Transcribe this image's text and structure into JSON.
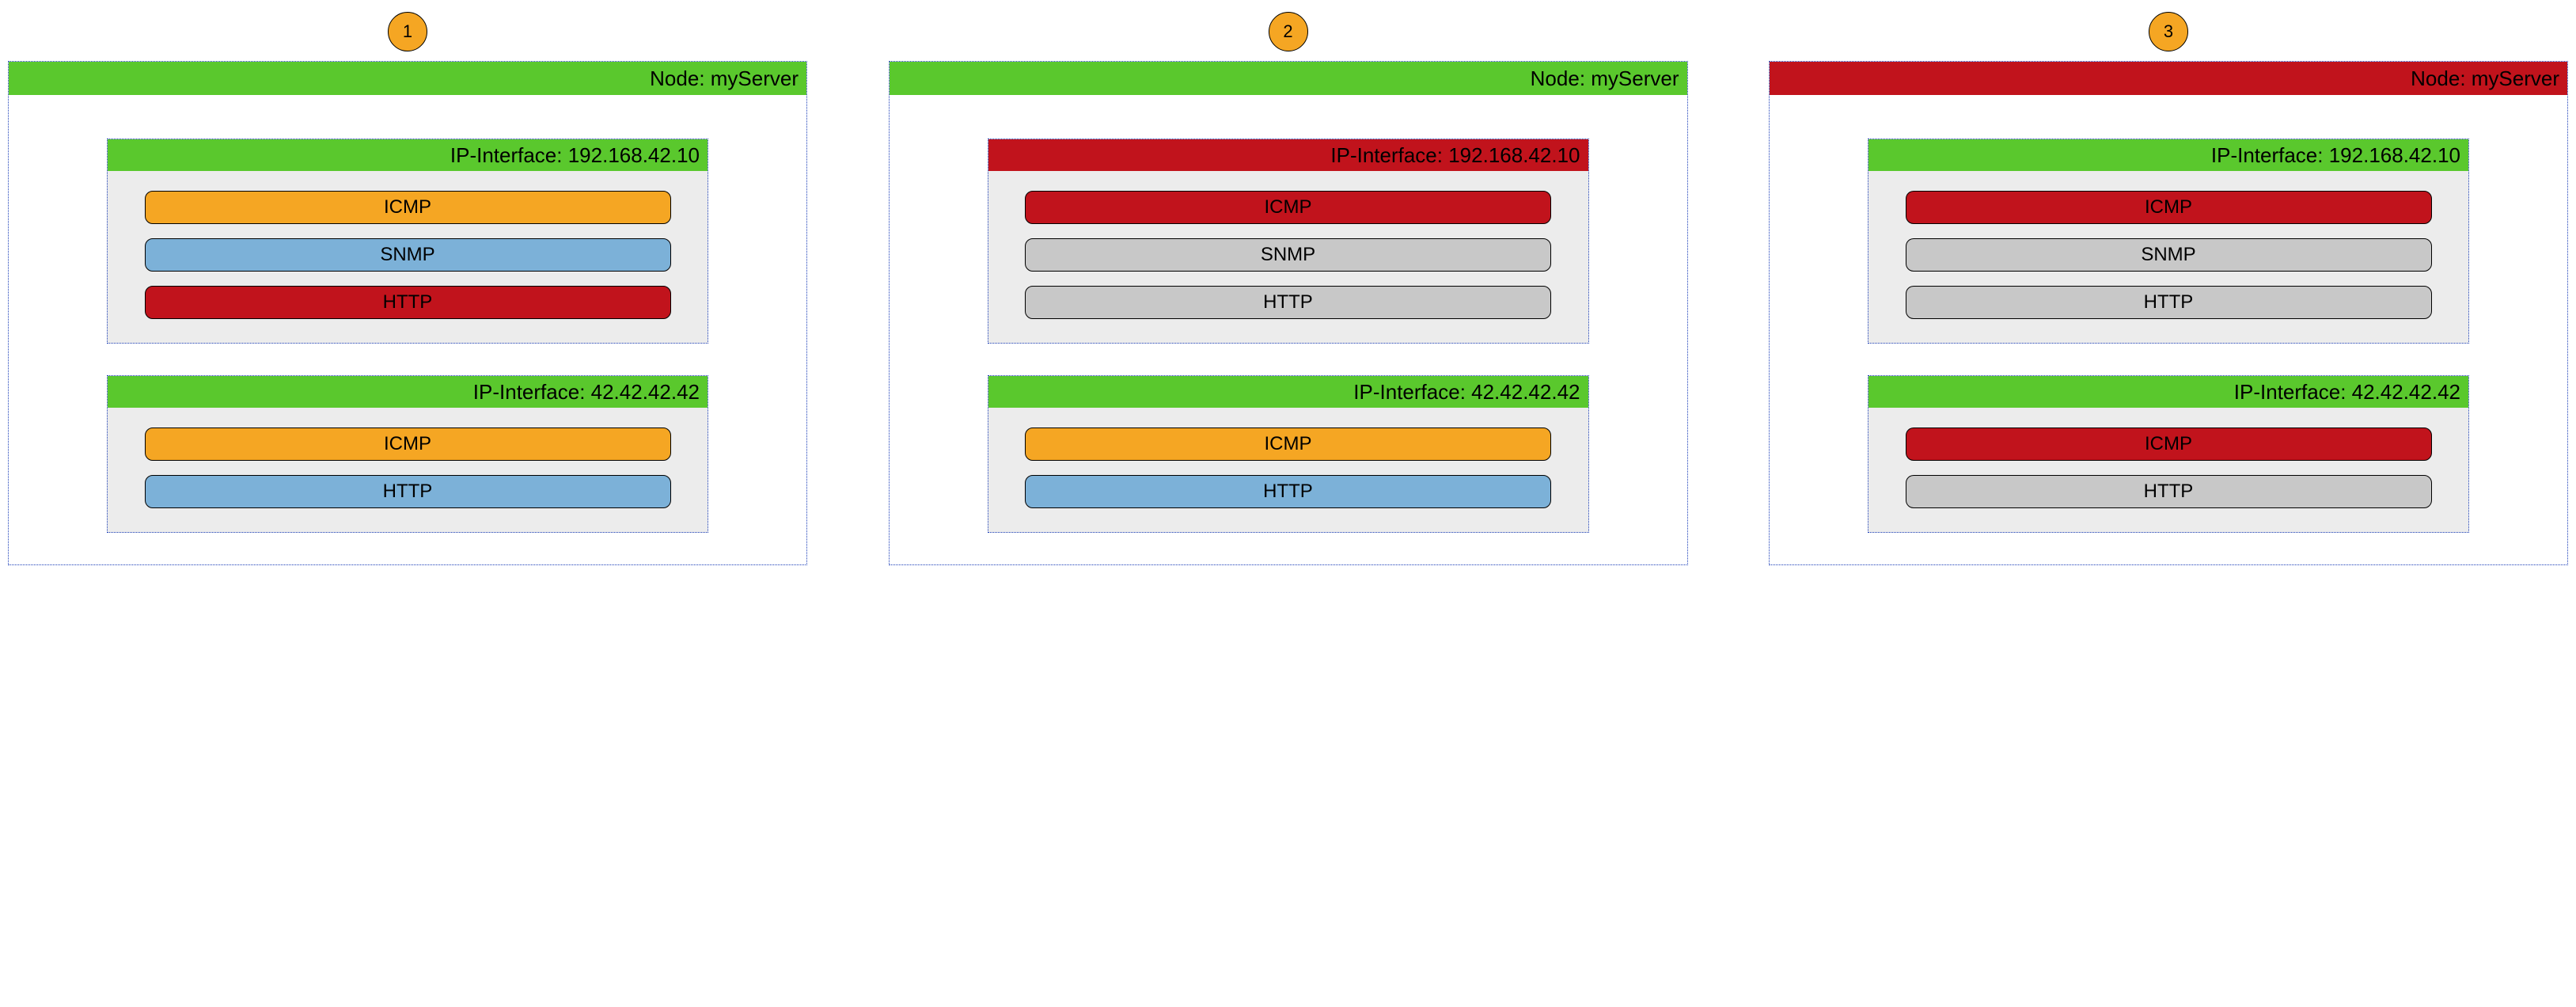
{
  "colors": {
    "green": "#5ac82d",
    "red": "#c1131c",
    "orange": "#f5a623",
    "blue": "#7cb1d8",
    "grey": "#c8c8c8"
  },
  "scenarios": [
    {
      "badge": "1",
      "node_label": "Node: myServer",
      "node_color": "green",
      "interfaces": [
        {
          "label": "IP-Interface: 192.168.42.10",
          "header_color": "green",
          "services": [
            {
              "name": "ICMP",
              "color": "orange"
            },
            {
              "name": "SNMP",
              "color": "blue"
            },
            {
              "name": "HTTP",
              "color": "red"
            }
          ]
        },
        {
          "label": "IP-Interface: 42.42.42.42",
          "header_color": "green",
          "services": [
            {
              "name": "ICMP",
              "color": "orange"
            },
            {
              "name": "HTTP",
              "color": "blue"
            }
          ]
        }
      ]
    },
    {
      "badge": "2",
      "node_label": "Node: myServer",
      "node_color": "green",
      "interfaces": [
        {
          "label": "IP-Interface: 192.168.42.10",
          "header_color": "red",
          "services": [
            {
              "name": "ICMP",
              "color": "red"
            },
            {
              "name": "SNMP",
              "color": "grey"
            },
            {
              "name": "HTTP",
              "color": "grey"
            }
          ]
        },
        {
          "label": "IP-Interface: 42.42.42.42",
          "header_color": "green",
          "services": [
            {
              "name": "ICMP",
              "color": "orange"
            },
            {
              "name": "HTTP",
              "color": "blue"
            }
          ]
        }
      ]
    },
    {
      "badge": "3",
      "node_label": "Node: myServer",
      "node_color": "red",
      "interfaces": [
        {
          "label": "IP-Interface: 192.168.42.10",
          "header_color": "green",
          "services": [
            {
              "name": "ICMP",
              "color": "red"
            },
            {
              "name": "SNMP",
              "color": "grey"
            },
            {
              "name": "HTTP",
              "color": "grey"
            }
          ]
        },
        {
          "label": "IP-Interface: 42.42.42.42",
          "header_color": "green",
          "services": [
            {
              "name": "ICMP",
              "color": "red"
            },
            {
              "name": "HTTP",
              "color": "grey"
            }
          ]
        }
      ]
    }
  ]
}
